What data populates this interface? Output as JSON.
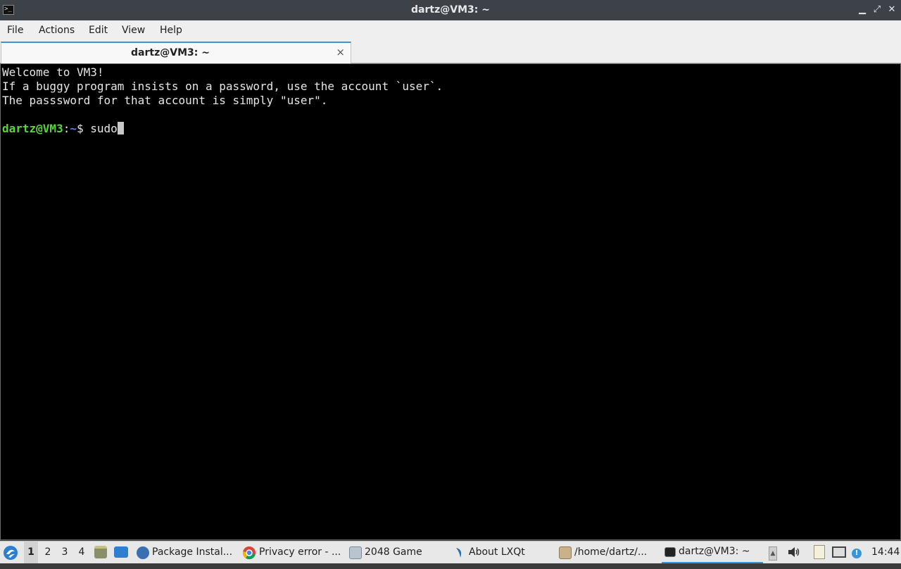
{
  "window": {
    "title": "dartz@VM3: ~",
    "minimize_glyph": "▁",
    "maximize_glyph": "⤢",
    "close_glyph": "✕",
    "app_icon_glyph": ">_"
  },
  "menubar": {
    "items": [
      "File",
      "Actions",
      "Edit",
      "View",
      "Help"
    ]
  },
  "tabs": [
    {
      "label": "dartz@VM3: ~",
      "close_glyph": "×"
    }
  ],
  "terminal": {
    "lines": [
      "Welcome to VM3!",
      "If a buggy program insists on a password, use the account `user`.",
      "The passsword for that account is simply \"user\"."
    ],
    "prompt": {
      "user_host": "dartz@VM3",
      "colon": ":",
      "path": "~",
      "symbol": "$ ",
      "command": "sudo"
    }
  },
  "taskbar": {
    "desktops": [
      "1",
      "2",
      "3",
      "4"
    ],
    "active_desktop": "1",
    "tasks": [
      {
        "label": "Package Instal...",
        "icon": "package-installer-icon"
      },
      {
        "label": "Privacy error - ...",
        "icon": "chrome-icon"
      },
      {
        "label": "2048 Game",
        "icon": "window-icon"
      },
      {
        "label": "About LXQt",
        "icon": "lxqt-icon"
      },
      {
        "label": "/home/dartz/...",
        "icon": "file-manager-icon"
      },
      {
        "label": "dartz@VM3: ~",
        "icon": "terminal-icon"
      }
    ],
    "clock": "14:44",
    "colors": {
      "accent": "#3a95d8",
      "prompt_user": "#58d53a",
      "prompt_path": "#5c7cff"
    }
  }
}
